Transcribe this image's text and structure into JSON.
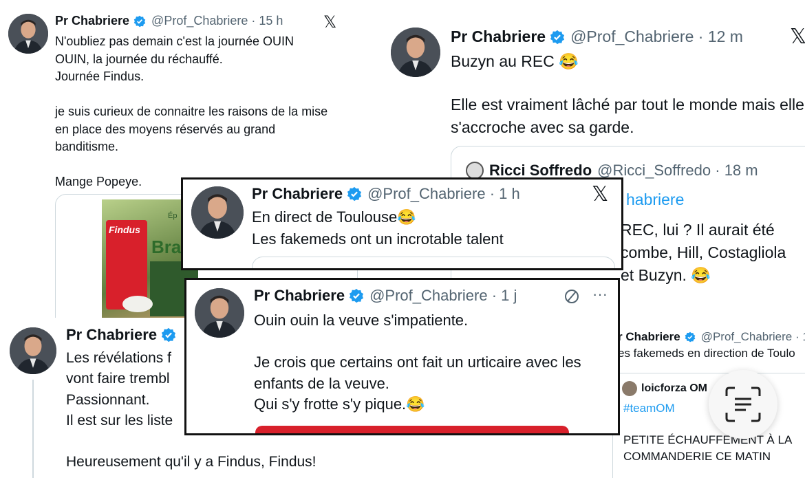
{
  "tweet_top_left": {
    "author": "Pr Chabriere",
    "handle": "@Prof_Chabriere · 15 h",
    "text": "N'oubliez pas demain c'est la journée OUIN OUIN, la journée du réchauffé.\nJournée Findus.\n\nje suis curieux de connaitre les raisons de la mise en place des moyens réservés au grand banditisme.\n\nMange Popeye.",
    "image_brand": "Findus",
    "image_fragments": [
      "Ép",
      "Bra"
    ]
  },
  "tweet_top_right": {
    "author": "Pr Chabriere",
    "handle": "@Prof_Chabriere · 12 m",
    "text_line1": "Buzyn au REC 😂",
    "text_line2": "Elle est vraiment lâché par tout le monde mais elle s'accroche avec sa garde.",
    "quote": {
      "author": "Ricci Soffredo",
      "handle": "@Ricci_Soffredo · 18 m",
      "reply_fragment": "habriere",
      "text_fragment": "REC, lui ? Il aurait été\ncombe, Hill, Costagliola\net Buzyn. 😂"
    }
  },
  "tweet_middle": {
    "author": "Pr Chabriere",
    "handle": "@Prof_Chabriere · 1 h",
    "text": "En direct de Toulouse😂\nLes fakemeds ont un incrotable talent"
  },
  "tweet_bottom_left": {
    "author": "Pr Chabriere",
    "text": "Les révélations  f\nvont faire trembl\nPassionnant.\nIl est sur les liste\n\nHeureusement qu'il y a Findus, Findus!"
  },
  "tweet_bottom_center": {
    "author": "Pr Chabriere",
    "handle": "@Prof_Chabriere · 1 j",
    "text": "Ouin ouin la veuve s'impatiente.\n\nJe crois que certains ont fait un urticaire avec les enfants de la veuve.\nQui s'y frotte s'y pique.😂"
  },
  "tweet_bottom_right": {
    "author": "r Chabriere",
    "handle": "@Prof_Chabriere · 1",
    "text": "es fakemeds en direction de Toulo",
    "quote_author": "loicforza OM",
    "quote_hashtag": "#teamOM",
    "quote_text": "PETITE ÉCHAUFFEMENT À LA\nCOMMANDERIE CE MATIN"
  },
  "icons": {
    "x_logo": "𝕏",
    "more": "···",
    "heart": "♡"
  },
  "colors": {
    "accent": "#1d9bf0",
    "verified": "#1d9bf0",
    "frame": "#111111",
    "findus_red": "#d8202b"
  }
}
